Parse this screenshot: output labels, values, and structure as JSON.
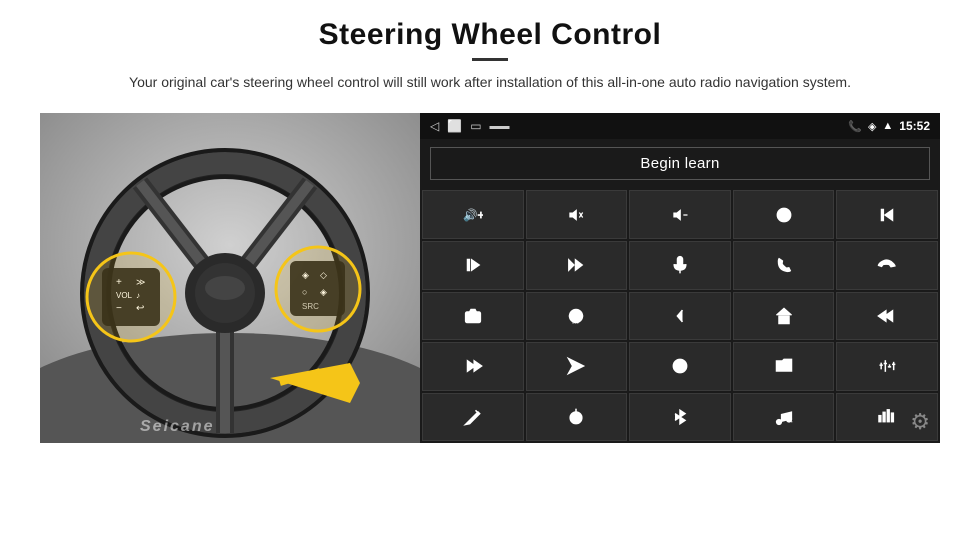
{
  "header": {
    "title": "Steering Wheel Control",
    "subtitle": "Your original car's steering wheel control will still work after installation of this all-in-one auto radio navigation system."
  },
  "statusBar": {
    "time": "15:52",
    "leftIcons": [
      "back-icon",
      "home-icon",
      "recents-icon",
      "signal-icon"
    ],
    "rightIcons": [
      "phone-icon",
      "wifi-icon",
      "signal-bars-icon",
      "time-label"
    ]
  },
  "beginLearnButton": {
    "label": "Begin learn"
  },
  "controls": [
    {
      "icon": "vol-up",
      "unicode": "🔊+"
    },
    {
      "icon": "vol-down",
      "unicode": "🔉−"
    },
    {
      "icon": "vol-mute",
      "unicode": "🔇"
    },
    {
      "icon": "power",
      "unicode": "⏻"
    },
    {
      "icon": "prev-track",
      "unicode": "⏮"
    },
    {
      "icon": "next-track",
      "unicode": "⏭"
    },
    {
      "icon": "next-prev",
      "unicode": "⏭⏪"
    },
    {
      "icon": "mic",
      "unicode": "🎤"
    },
    {
      "icon": "phone",
      "unicode": "📞"
    },
    {
      "icon": "hang-up",
      "unicode": "📵"
    },
    {
      "icon": "cam",
      "unicode": "📷"
    },
    {
      "icon": "360",
      "unicode": "360°"
    },
    {
      "icon": "back-nav",
      "unicode": "↩"
    },
    {
      "icon": "home-nav",
      "unicode": "🏠"
    },
    {
      "icon": "skip-back",
      "unicode": "⏮"
    },
    {
      "icon": "fast-forward",
      "unicode": "⏩"
    },
    {
      "icon": "navigate",
      "unicode": "➤"
    },
    {
      "icon": "swap",
      "unicode": "⇄"
    },
    {
      "icon": "folder",
      "unicode": "📁"
    },
    {
      "icon": "eq",
      "unicode": "🎚"
    },
    {
      "icon": "pen",
      "unicode": "✏"
    },
    {
      "icon": "power2",
      "unicode": "⏻"
    },
    {
      "icon": "bluetooth",
      "unicode": "⚡"
    },
    {
      "icon": "music",
      "unicode": "♪"
    },
    {
      "icon": "sound-bars",
      "unicode": "📊"
    }
  ],
  "watermark": "Seicane",
  "settingsIcon": "⚙"
}
